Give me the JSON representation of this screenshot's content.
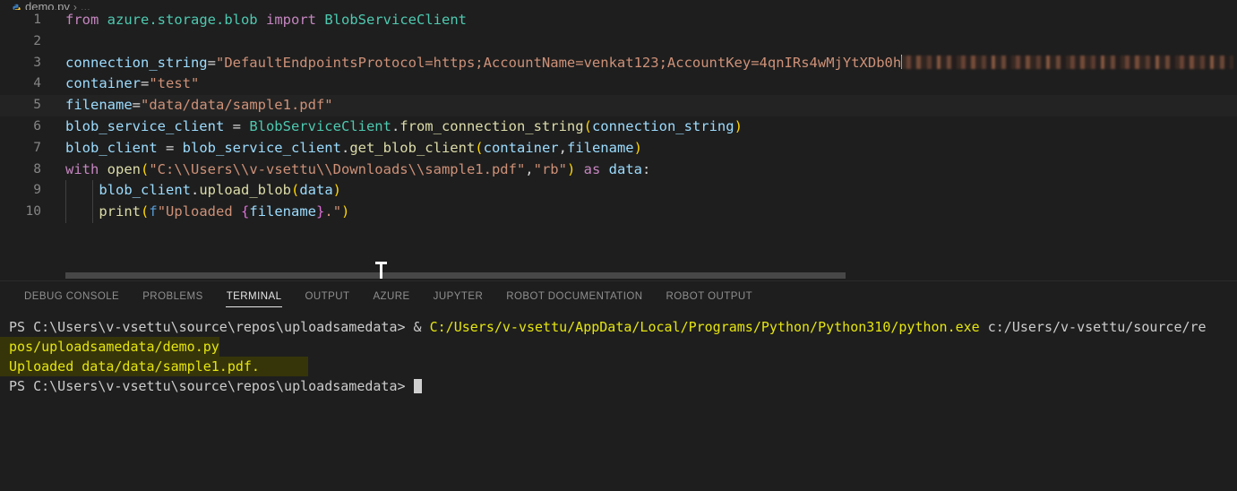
{
  "breadcrumb": {
    "file": "demo.py",
    "separator": "›",
    "dots": "...",
    "icon": "python-file-icon"
  },
  "editor": {
    "language": "python",
    "current_line": 5,
    "lines": [
      {
        "number": "1",
        "text": "from azure.storage.blob import BlobServiceClient"
      },
      {
        "number": "2",
        "text": ""
      },
      {
        "number": "3",
        "text": "connection_string=\"DefaultEndpointsProtocol=https;AccountName=venkat123;AccountKey=4qnIRs4wMjYtXDb0h"
      },
      {
        "number": "4",
        "text": "container=\"test\""
      },
      {
        "number": "5",
        "text": "filename=\"data/data/sample1.pdf\""
      },
      {
        "number": "6",
        "text": "blob_service_client = BlobServiceClient.from_connection_string(connection_string)"
      },
      {
        "number": "7",
        "text": "blob_client = blob_service_client.get_blob_client(container,filename)"
      },
      {
        "number": "8",
        "text": "with open(\"C:\\\\Users\\\\v-vsettu\\\\Downloads\\\\sample1.pdf\",\"rb\") as data:"
      },
      {
        "number": "9",
        "text": "    blob_client.upload_blob(data)"
      },
      {
        "number": "10",
        "text": "    print(f\"Uploaded {filename}.\")"
      }
    ],
    "tokens": {
      "l1_from": "from",
      "l1_module": "azure.storage.blob",
      "l1_import": "import",
      "l1_class": "BlobServiceClient",
      "l3_var": "connection_string",
      "l3_eq": "=",
      "l3_str": "\"DefaultEndpointsProtocol=https;AccountName=venkat123;AccountKey=4qnIRs4wMjYtXDb0h",
      "l3_redacted_note": "redacted-blur",
      "l4_var": "container",
      "l4_str": "\"test\"",
      "l5_var": "filename",
      "l5_str": "\"data/data/sample1.pdf\"",
      "l6_var": "blob_service_client",
      "l6_class": "BlobServiceClient",
      "l6_attr": ".",
      "l6_fn": "from_connection_string",
      "l6_arg": "connection_string",
      "l7_var": "blob_client",
      "l7_obj": "blob_service_client",
      "l7_fn": "get_blob_client",
      "l7_arg1": "container",
      "l7_arg2": "filename",
      "l8_with": "with",
      "l8_open": "open",
      "l8_path": "\"C:\\\\Users\\\\v-vsettu\\\\Downloads\\\\sample1.pdf\"",
      "l8_mode": "\"rb\"",
      "l8_as": "as",
      "l8_data": "data",
      "l9_obj": "blob_client",
      "l9_fn": "upload_blob",
      "l9_arg": "data",
      "l10_fn": "print",
      "l10_f": "f",
      "l10_str_a": "\"Uploaded ",
      "l10_brace_open": "{",
      "l10_brace_var": "filename",
      "l10_brace_close": "}",
      "l10_str_b": ".\""
    }
  },
  "panel": {
    "tabs": [
      {
        "label": "DEBUG CONSOLE",
        "active": false
      },
      {
        "label": "PROBLEMS",
        "active": false
      },
      {
        "label": "TERMINAL",
        "active": true
      },
      {
        "label": "OUTPUT",
        "active": false
      },
      {
        "label": "AZURE",
        "active": false
      },
      {
        "label": "JUPYTER",
        "active": false
      },
      {
        "label": "ROBOT DOCUMENTATION",
        "active": false
      },
      {
        "label": "ROBOT OUTPUT",
        "active": false
      }
    ],
    "terminal": {
      "line1_prompt": "PS C:\\Users\\v-vsettu\\source\\repos\\uploadsamedata> ",
      "line1_amp": "& ",
      "line1_cmd": "C:/Users/v-vsettu/AppData/Local/Programs/Python/Python310/python.exe ",
      "line1_arg": "c:/Users/v-vsettu/source/re",
      "line2_wrap": "pos/uploadsamedata/demo.py",
      "line3_output": "Uploaded data/data/sample1.pdf.",
      "line4_prompt": "PS C:\\Users\\v-vsettu\\source\\repos\\uploadsamedata> ",
      "cursor": "block-cursor"
    }
  },
  "colors": {
    "editor_bg": "#1e1e1e",
    "panel_bg": "#1e1e1e",
    "keyword": "#c586c0",
    "class": "#4ec9b0",
    "variable": "#9cdcfe",
    "string": "#ce9178",
    "function": "#dcdcaa",
    "paren": "#ffd700",
    "terminal_yellow": "#e5e510",
    "terminal_fg": "#cccccc",
    "selection": "#36350a",
    "scrollbar": "#474747",
    "active_tab": "#e7e7e7"
  }
}
